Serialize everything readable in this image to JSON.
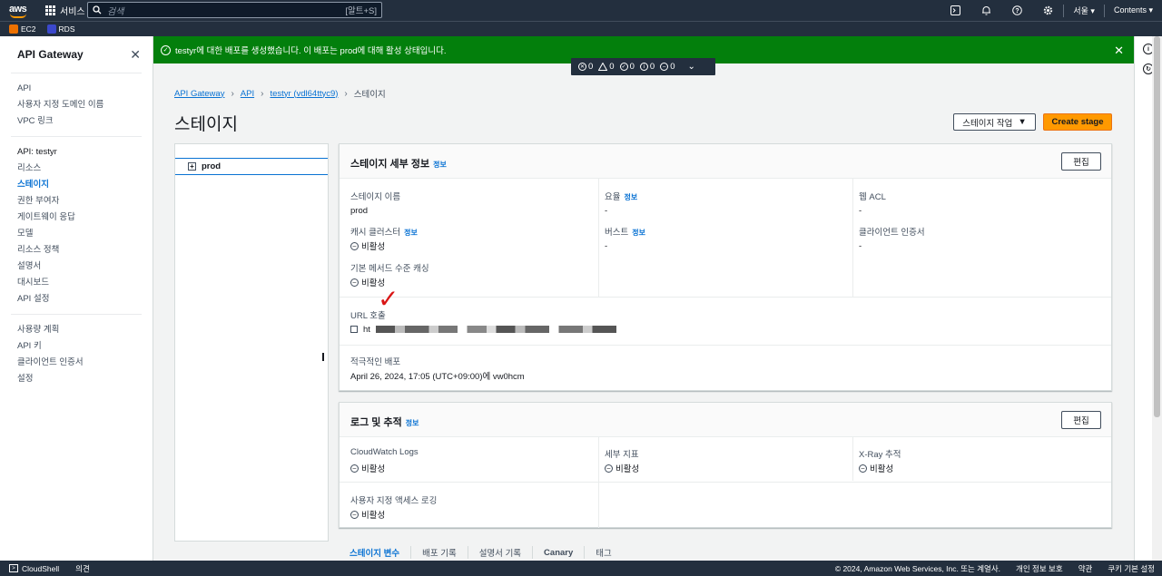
{
  "topnav": {
    "logo": "aws",
    "services_label": "서비스",
    "search_placeholder": "검색",
    "search_shortcut": "[알트+S]",
    "region": "서울 ▾",
    "account": "Contents ▾",
    "icons": [
      "cloudshell-icon",
      "bell-icon",
      "help-icon",
      "settings-icon"
    ]
  },
  "favorites": [
    {
      "label": "EC2",
      "color": "#ed7100"
    },
    {
      "label": "RDS",
      "color": "#3b48cc"
    }
  ],
  "sidebar": {
    "title": "API Gateway",
    "top_items": [
      "API",
      "사용자 지정 도메인 이름",
      "VPC 링크"
    ],
    "api_section": "API: testyr",
    "api_items": [
      {
        "label": "리소스",
        "active": false
      },
      {
        "label": "스테이지",
        "active": true
      },
      {
        "label": "권한 부여자",
        "active": false
      },
      {
        "label": "게이트웨이 응답",
        "active": false
      },
      {
        "label": "모델",
        "active": false
      },
      {
        "label": "리소스 정책",
        "active": false
      },
      {
        "label": "설명서",
        "active": false
      },
      {
        "label": "대시보드",
        "active": false
      },
      {
        "label": "API 설정",
        "active": false
      }
    ],
    "bottom_items": [
      "사용량 계획",
      "API 키",
      "클라이언트 인증서",
      "설정"
    ]
  },
  "flash": {
    "message": "testyr에 대한 배포를 생성했습니다. 이 배포는 prod에 대해 활성 상태입니다.",
    "color": "#037f0c"
  },
  "counter": {
    "error": "0",
    "warning": "0",
    "success": "0",
    "info": "0",
    "in_progress": "0"
  },
  "breadcrumb": {
    "items": [
      "API Gateway",
      "API",
      "testyr (vdl64ttyc9)"
    ],
    "current": "스테이지"
  },
  "page": {
    "title": "스테이지",
    "actions_button": "스테이지 작업",
    "create_button": "Create stage"
  },
  "tree": {
    "stage": "prod"
  },
  "stage_details": {
    "title": "스테이지 세부 정보",
    "info": "정보",
    "edit": "편집",
    "fields": {
      "stage_name": {
        "label": "스테이지 이름",
        "value": "prod"
      },
      "rate": {
        "label": "요율",
        "value": "-"
      },
      "waf": {
        "label": "웹 ACL",
        "value": "-"
      },
      "cache": {
        "label": "캐시 클러스터",
        "value": "비활성"
      },
      "burst": {
        "label": "버스트",
        "value": "-"
      },
      "client_cert": {
        "label": "클라이언트 인증서",
        "value": "-"
      },
      "method_cache": {
        "label": "기본 메서드 수준 캐싱",
        "value": "비활성"
      }
    },
    "invoke_url_label": "URL 호출",
    "invoke_url_prefix": "ht",
    "active_deployment_label": "적극적인 배포",
    "active_deployment_value": "April 26, 2024, 17:05 (UTC+09:00)에 vw0hcm"
  },
  "logs": {
    "title": "로그 및 추적",
    "info": "정보",
    "edit": "편집",
    "fields": {
      "cloudwatch": {
        "label": "CloudWatch Logs",
        "value": "비활성"
      },
      "metrics": {
        "label": "세부 지표",
        "value": "비활성"
      },
      "xray": {
        "label": "X-Ray 추적",
        "value": "비활성"
      },
      "access_log": {
        "label": "사용자 지정 액세스 로깅",
        "value": "비활성"
      }
    }
  },
  "tabs": [
    {
      "label": "스테이지 변수",
      "active": true
    },
    {
      "label": "배포 기록",
      "active": false
    },
    {
      "label": "설명서 기록",
      "active": false
    },
    {
      "label": "Canary",
      "active": false
    },
    {
      "label": "태그",
      "active": false
    }
  ],
  "footer": {
    "cloudshell": "CloudShell",
    "feedback": "의견",
    "copyright": "© 2024, Amazon Web Services, Inc. 또는 계열사.",
    "privacy": "개인 정보 보호",
    "terms": "약관",
    "cookies": "쿠키 기본 설정"
  }
}
